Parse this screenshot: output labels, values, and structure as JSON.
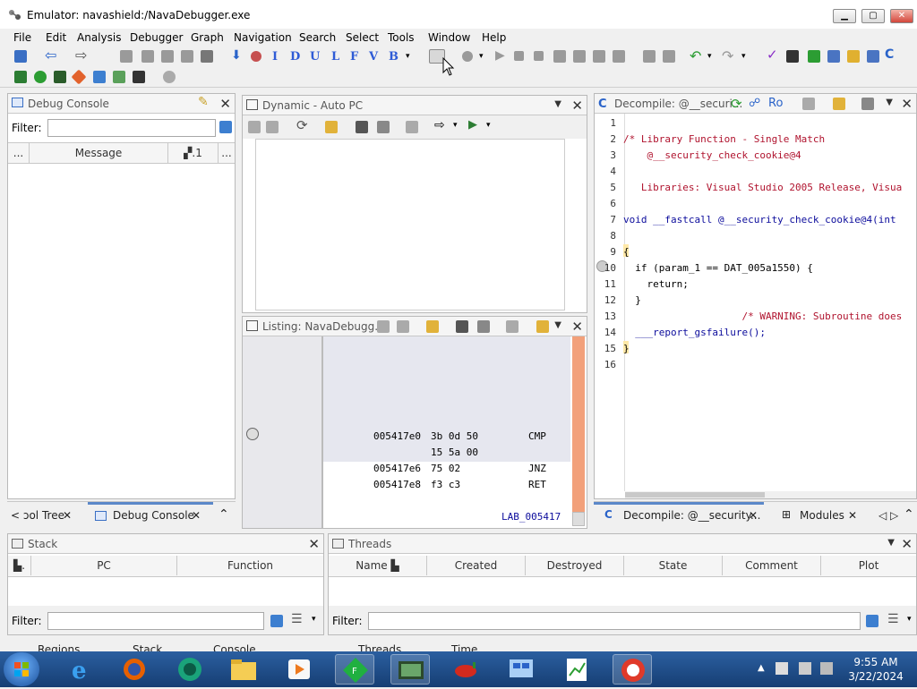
{
  "window": {
    "title": "Emulator: navashield:/NavaDebugger.exe"
  },
  "menu": [
    "File",
    "Edit",
    "Analysis",
    "Debugger",
    "Graph",
    "Navigation",
    "Search",
    "Select",
    "Tools",
    "Window",
    "Help"
  ],
  "toolbar": {
    "letters": [
      "I",
      "D",
      "U",
      "L",
      "F",
      "V",
      "B"
    ]
  },
  "debug_console": {
    "title": "Debug Console",
    "filter_label": "Filter:",
    "filter_value": "",
    "col_dots": "...",
    "col_message": "Message",
    "col_icon": "▞.1",
    "col_dots2": "..."
  },
  "left_tabs": {
    "tab1": "< ɔol Tree",
    "tab2": "Debug Console"
  },
  "dynamic": {
    "title": "Dynamic - Auto PC"
  },
  "listing": {
    "title": "Listing:  NavaDebugg...",
    "rows": [
      {
        "addr": "005417e0",
        "bytes": "3b 0d 50",
        "mnem": "CMP"
      },
      {
        "addr": "",
        "bytes": "15 5a 00",
        "mnem": ""
      },
      {
        "addr": "005417e6",
        "bytes": "75 02",
        "mnem": "JNZ"
      },
      {
        "addr": "005417e8",
        "bytes": "f3 c3",
        "mnem": "RET"
      }
    ],
    "bottom_label": "LAB_005417"
  },
  "decompile": {
    "title": "Decompile: @__securi...",
    "ro": "Ro",
    "lines": [
      {
        "n": "1",
        "t": ""
      },
      {
        "n": "2",
        "t": "/* Library Function - Single Match"
      },
      {
        "n": "3",
        "t": "    @__security_check_cookie@4"
      },
      {
        "n": "4",
        "t": ""
      },
      {
        "n": "5",
        "t": "   Libraries: Visual Studio 2005 Release, Visua"
      },
      {
        "n": "6",
        "t": ""
      },
      {
        "n": "7",
        "t": "void __fastcall @__security_check_cookie@4(int"
      },
      {
        "n": "8",
        "t": ""
      },
      {
        "n": "9",
        "t": "{"
      },
      {
        "n": "10",
        "t": "  if (param_1 == DAT_005a1550) {"
      },
      {
        "n": "11",
        "t": "    return;"
      },
      {
        "n": "12",
        "t": "  }"
      },
      {
        "n": "13",
        "t": "                    /* WARNING: Subroutine does"
      },
      {
        "n": "14",
        "t": "  ___report_gsfailure();"
      },
      {
        "n": "15",
        "t": "}"
      },
      {
        "n": "16",
        "t": ""
      }
    ]
  },
  "right_tabs": {
    "tab1": "Decompile: @__security...",
    "tab2": "Modules",
    "tab3": "◁ ▷"
  },
  "stack": {
    "title": "Stack",
    "col1": "",
    "col_pc": "PC",
    "col_function": "Function",
    "filter_label": "Filter:"
  },
  "threads": {
    "title": "Threads",
    "cols": [
      "Name",
      "Created",
      "Destroyed",
      "State",
      "Comment",
      "Plot"
    ],
    "filter_label": "Filter:"
  },
  "bottom_tabs": [
    "Regions",
    "Stack",
    "Console",
    "Threads",
    "Time"
  ],
  "clock": {
    "time": "9:55 AM",
    "date": "3/22/2024"
  }
}
